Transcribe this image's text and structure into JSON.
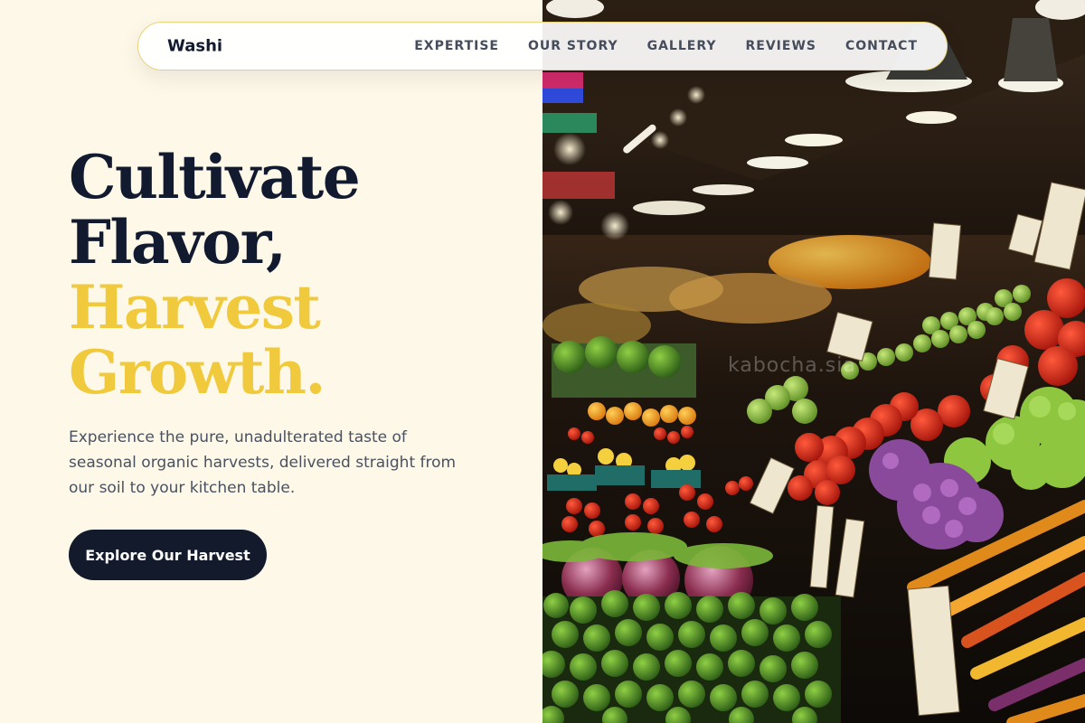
{
  "nav": {
    "brand": "Washi",
    "links": [
      "EXPERTISE",
      "OUR STORY",
      "GALLERY",
      "REVIEWS",
      "CONTACT"
    ]
  },
  "hero": {
    "headline_line1": "Cultivate",
    "headline_line2": "Flavor,",
    "headline_line3": "Harvest",
    "headline_line4": "Growth.",
    "subtext": "Experience the pure, unadulterated taste of seasonal organic harvests, delivered straight from our soil to your kitchen table.",
    "cta_label": "Explore Our Harvest"
  },
  "image": {
    "watermark": "kabocha.sia"
  },
  "colors": {
    "background": "#fdf8e8",
    "headline_dark": "#111a2e",
    "headline_accent": "#f0c93c",
    "button": "#121a2c",
    "nav_border": "#e9d27a"
  }
}
